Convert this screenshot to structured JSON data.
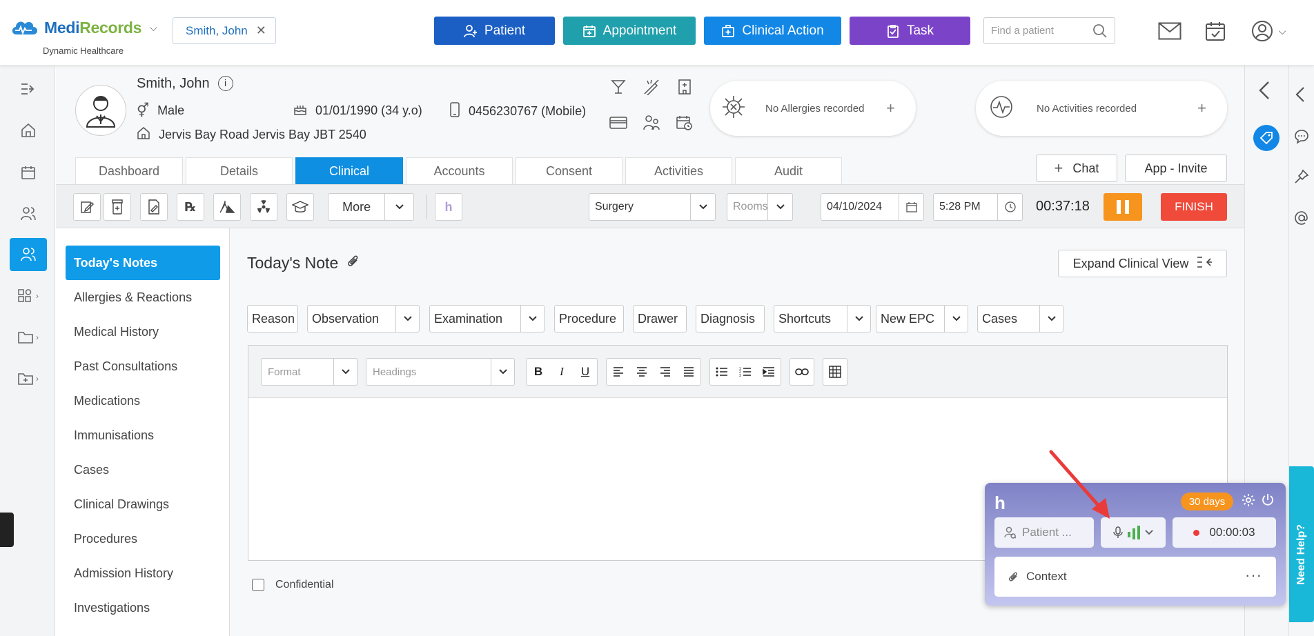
{
  "app": {
    "name_part1": "Medi",
    "name_part2": "Records",
    "subtitle": "Dynamic Healthcare"
  },
  "topbar": {
    "patient_chip": "Smith, John",
    "buttons": {
      "patient": "Patient",
      "appointment": "Appointment",
      "clinical_action": "Clinical Action",
      "task": "Task"
    },
    "search_placeholder": "Find a patient"
  },
  "patient": {
    "name": "Smith, John",
    "gender": "Male",
    "dob": "01/01/1990 (34 y.o)",
    "phone": "0456230767 (Mobile)",
    "address": "Jervis Bay Road Jervis Bay JBT 2540"
  },
  "cards": {
    "allergies": "No Allergies recorded",
    "activities": "No Activities recorded"
  },
  "tabs": [
    "Dashboard",
    "Details",
    "Clinical",
    "Accounts",
    "Consent",
    "Activities",
    "Audit"
  ],
  "active_tab": "Clinical",
  "header_actions": {
    "chat": "Chat",
    "app_invite": "App - Invite"
  },
  "toolbar": {
    "more": "More",
    "location": "Surgery",
    "rooms_placeholder": "Rooms",
    "date": "04/10/2024",
    "time": "5:28 PM",
    "timer": "00:37:18",
    "finish": "FINISH"
  },
  "left_nav": [
    "Today's Notes",
    "Allergies & Reactions",
    "Medical History",
    "Past Consultations",
    "Medications",
    "Immunisations",
    "Cases",
    "Clinical Drawings",
    "Procedures",
    "Admission History",
    "Investigations"
  ],
  "note": {
    "title": "Today's Note",
    "expand_button": "Expand Clinical View",
    "templates": [
      "Reason",
      "Observation",
      "Examination",
      "Procedure",
      "Drawer",
      "Diagnosis",
      "Shortcuts",
      "New EPC",
      "Cases"
    ],
    "format_placeholder": "Format",
    "headings_placeholder": "Headings",
    "confidential_label": "Confidential"
  },
  "widget": {
    "days_badge": "30 days",
    "patient_placeholder": "Patient ...",
    "rec_timer": "00:00:03",
    "context_label": "Context"
  },
  "help": "Need Help?",
  "colors": {
    "primary": "#1287e6",
    "patient_btn": "#1b5fc4",
    "appointment_btn": "#20a0ac",
    "task_btn": "#7b44c8",
    "pause": "#f7941d",
    "finish": "#ef4a3a"
  }
}
